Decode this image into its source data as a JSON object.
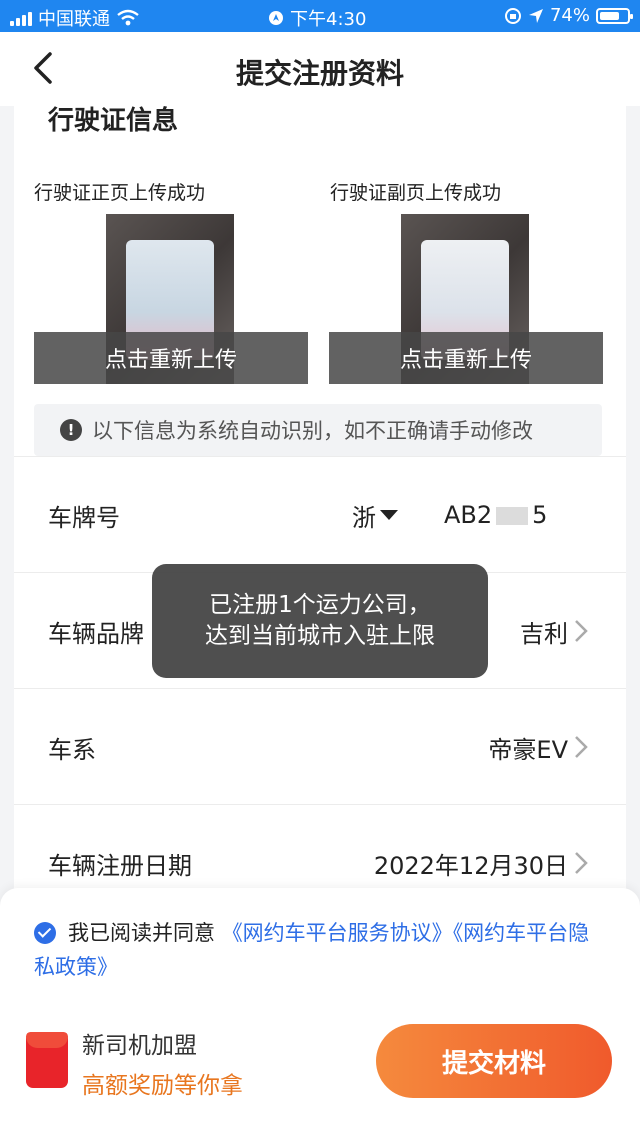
{
  "status_bar": {
    "carrier": "中国联通",
    "time": "下午4:30",
    "battery_percent": "74%",
    "battery_level": 0.74,
    "accent_color": "#1f86f0"
  },
  "nav": {
    "title": "提交注册资料",
    "back_icon": "chevron-left-icon"
  },
  "license_section": {
    "title": "行驶证信息",
    "front": {
      "label": "行驶证正页上传成功",
      "reupload": "点击重新上传"
    },
    "back": {
      "label": "行驶证副页上传成功",
      "reupload": "点击重新上传"
    }
  },
  "notice": {
    "icon": "exclamation-icon",
    "text": "以下信息为系统自动识别，如不正确请手动修改"
  },
  "form": {
    "plate": {
      "label": "车牌号",
      "province": "浙",
      "number": "AB2",
      "suffix": "5"
    },
    "brand": {
      "label": "车辆品牌",
      "value": "吉利"
    },
    "series": {
      "label": "车系",
      "value": "帝豪EV"
    },
    "reg_date": {
      "label": "车辆注册日期",
      "value": "2022年12月30日"
    }
  },
  "toast": {
    "line1": "已注册1个运力公司，",
    "line2": "达到当前城市入驻上限"
  },
  "agreement": {
    "prefix": "我已阅读并同意",
    "link1": "《网约车平台服务协议》",
    "link2": "《网约车平台隐私政策》"
  },
  "promo": {
    "line1": "新司机加盟",
    "line2": "高额奖励等你拿"
  },
  "submit_label": "提交材料",
  "colors": {
    "link": "#2e6ee6",
    "submit_start": "#f58a3d",
    "submit_end": "#f05a2c",
    "promo": "#e8761f"
  }
}
